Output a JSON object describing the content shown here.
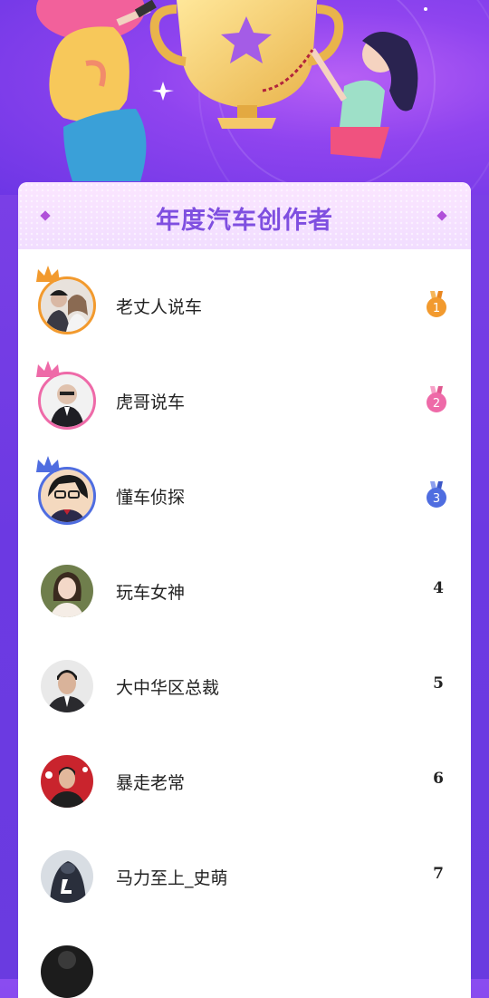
{
  "title": "年度汽车创作者",
  "creators": [
    {
      "name": "老丈人说车",
      "rank": "1",
      "medal": "gold"
    },
    {
      "name": "虎哥说车",
      "rank": "2",
      "medal": "pink"
    },
    {
      "name": "懂车侦探",
      "rank": "3",
      "medal": "blue"
    },
    {
      "name": "玩车女神",
      "rank": "4"
    },
    {
      "name": "大中华区总裁",
      "rank": "5"
    },
    {
      "name": "暴走老常",
      "rank": "6"
    },
    {
      "name": "马力至上_史萌",
      "rank": "7"
    }
  ],
  "colors": {
    "gold": "#f29a2e",
    "pink": "#ee6aa8",
    "blue": "#4f6de0",
    "accent": "#7f4fe0"
  },
  "icons": {
    "hero": "trophy-illustration",
    "crown": "crown-icon",
    "medal": "medal-icon"
  }
}
